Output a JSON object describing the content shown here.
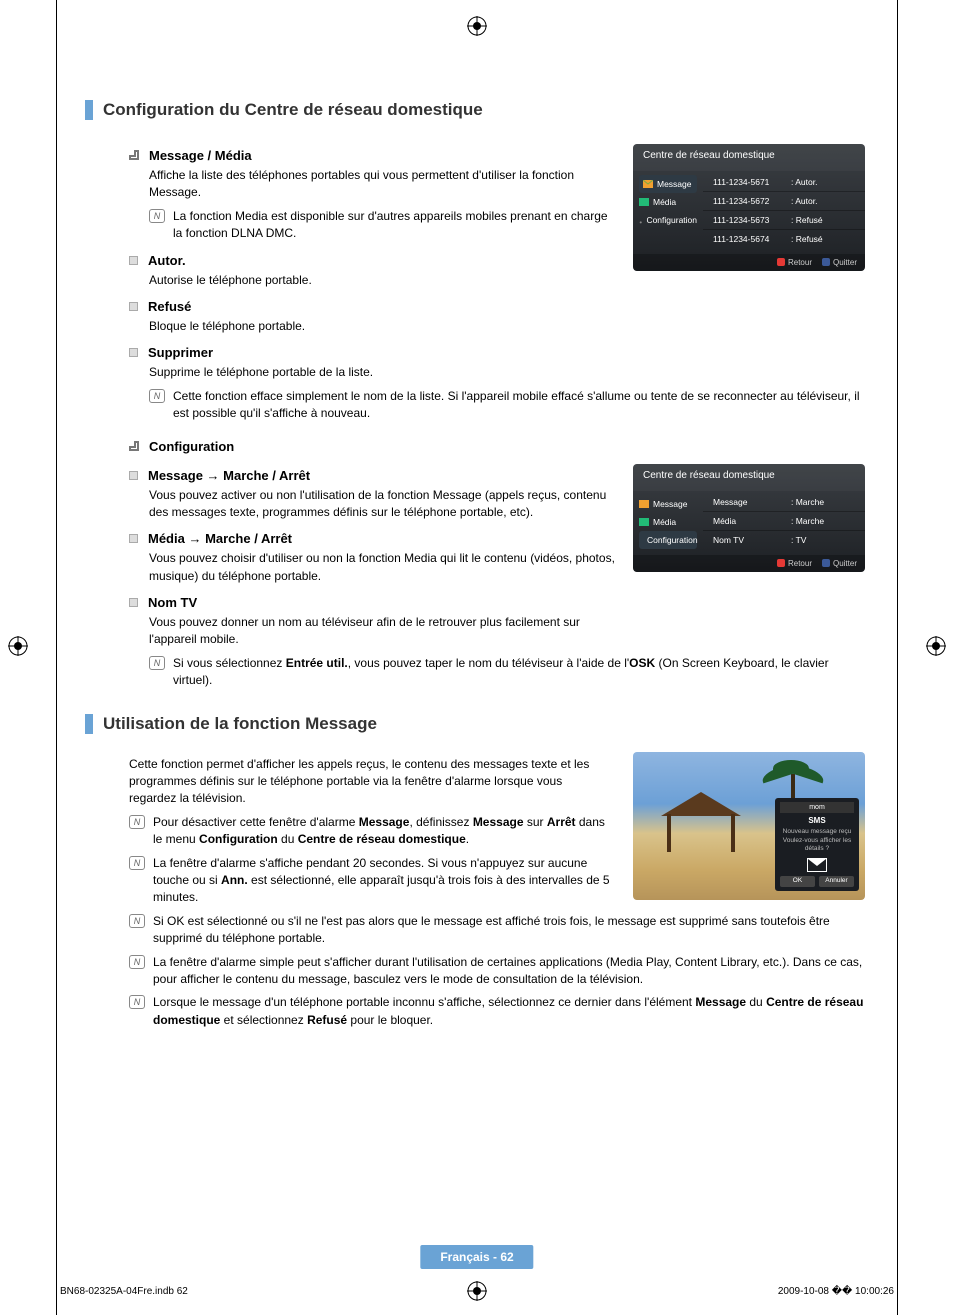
{
  "section1": {
    "title": "Configuration du Centre de réseau domestique",
    "msg_media_head": "Message / Média",
    "msg_media_body": "Affiche la liste des téléphones portables qui vous permettent d'utiliser la fonction Message.",
    "note1": "La fonction Media est disponible sur d'autres appareils mobiles prenant en charge la fonction DLNA DMC.",
    "autor_head": "Autor.",
    "autor_body": "Autorise le téléphone portable.",
    "refuse_head": "Refusé",
    "refuse_body": "Bloque le téléphone portable.",
    "suppr_head": "Supprimer",
    "suppr_body": "Supprime le téléphone portable de la liste.",
    "suppr_note": "Cette fonction efface simplement le nom de la liste. Si l'appareil mobile effacé s'allume ou tente de se reconnecter au téléviseur, il est possible qu'il s'affiche à nouveau.",
    "config_head": "Configuration",
    "msg_head": "Message → Marche / Arrêt",
    "msg_body": "Vous pouvez activer ou non l'utilisation de la fonction Message (appels reçus, contenu des messages texte, programmes définis sur le téléphone portable, etc).",
    "media_head": "Média → Marche / Arrêt",
    "media_body": "Vous pouvez choisir d'utiliser ou non la fonction Media qui lit le contenu (vidéos, photos, musique) du téléphone portable.",
    "nomtv_head": "Nom TV",
    "nomtv_body": "Vous pouvez donner un nom au téléviseur afin de le retrouver plus facilement sur l'appareil mobile.",
    "nomtv_note_a": "Si vous sélectionnez ",
    "nomtv_note_b": "Entrée util.",
    "nomtv_note_c": ", vous pouvez taper le nom du téléviseur à l'aide de l'",
    "nomtv_note_d": "OSK",
    "nomtv_note_e": " (On Screen Keyboard, le clavier virtuel)."
  },
  "osd1": {
    "title": "Centre de réseau domestique",
    "side": [
      "Message",
      "Média",
      "Configuration"
    ],
    "rows": [
      {
        "a": "111-1234-5671",
        "b": ": Autor."
      },
      {
        "a": "111-1234-5672",
        "b": ": Autor."
      },
      {
        "a": "111-1234-5673",
        "b": ": Refusé"
      },
      {
        "a": "111-1234-5674",
        "b": ": Refusé"
      }
    ],
    "ret": "Retour",
    "quit": "Quitter"
  },
  "osd2": {
    "title": "Centre de réseau domestique",
    "side": [
      "Message",
      "Média",
      "Configuration"
    ],
    "rows": [
      {
        "a": "Message",
        "b": ": Marche"
      },
      {
        "a": "Média",
        "b": ": Marche"
      },
      {
        "a": "Nom TV",
        "b": ": TV"
      }
    ],
    "ret": "Retour",
    "quit": "Quitter"
  },
  "section2": {
    "title": "Utilisation de la fonction Message",
    "intro": "Cette fonction permet d'afficher les appels reçus, le contenu des messages texte et les programmes définis sur le téléphone portable via la fenêtre d'alarme lorsque vous regardez la télévision.",
    "n1_a": "Pour désactiver cette fenêtre d'alarme ",
    "n1_b": "Message",
    "n1_c": ", définissez ",
    "n1_d": "Message",
    "n1_e": " sur ",
    "n1_f": "Arrêt",
    "n1_g": " dans le menu ",
    "n1_h": "Configuration",
    "n1_i": " du ",
    "n1_j": "Centre de réseau domestique",
    "n1_k": ".",
    "n2_a": "La fenêtre d'alarme s'affiche pendant 20 secondes. Si vous n'appuyez sur aucune touche ou si ",
    "n2_b": "Ann.",
    "n2_c": " est sélectionné, elle apparaît jusqu'à trois fois à des intervalles de 5 minutes.",
    "n3": "Si OK est sélectionné ou s'il ne l'est pas alors que le message est affiché trois fois, le message est supprimé sans toutefois être supprimé du téléphone portable.",
    "n4": "La fenêtre d'alarme simple peut s'afficher durant l'utilisation de certaines applications (Media Play, Content Library, etc.). Dans ce cas, pour afficher le contenu du message, basculez vers le mode de consultation de la télévision.",
    "n5_a": "Lorsque le message d'un téléphone portable inconnu s'affiche, sélectionnez ce dernier dans l'élément ",
    "n5_b": "Message",
    "n5_c": " du ",
    "n5_d": "Centre de réseau domestique",
    "n5_e": " et sélectionnez ",
    "n5_f": "Refusé",
    "n5_g": " pour le bloquer."
  },
  "popup": {
    "bar": "mom",
    "title": "SMS",
    "sub1": "Nouveau message reçu",
    "sub2": "Voulez-vous afficher les détails ?",
    "ok": "OK",
    "cancel": "Annuler"
  },
  "pagefoot": "Français - 62",
  "docfoot_l": "BN68-02325A-04Fre.indb   62",
  "docfoot_r": "2009-10-08   �� 10:00:26"
}
